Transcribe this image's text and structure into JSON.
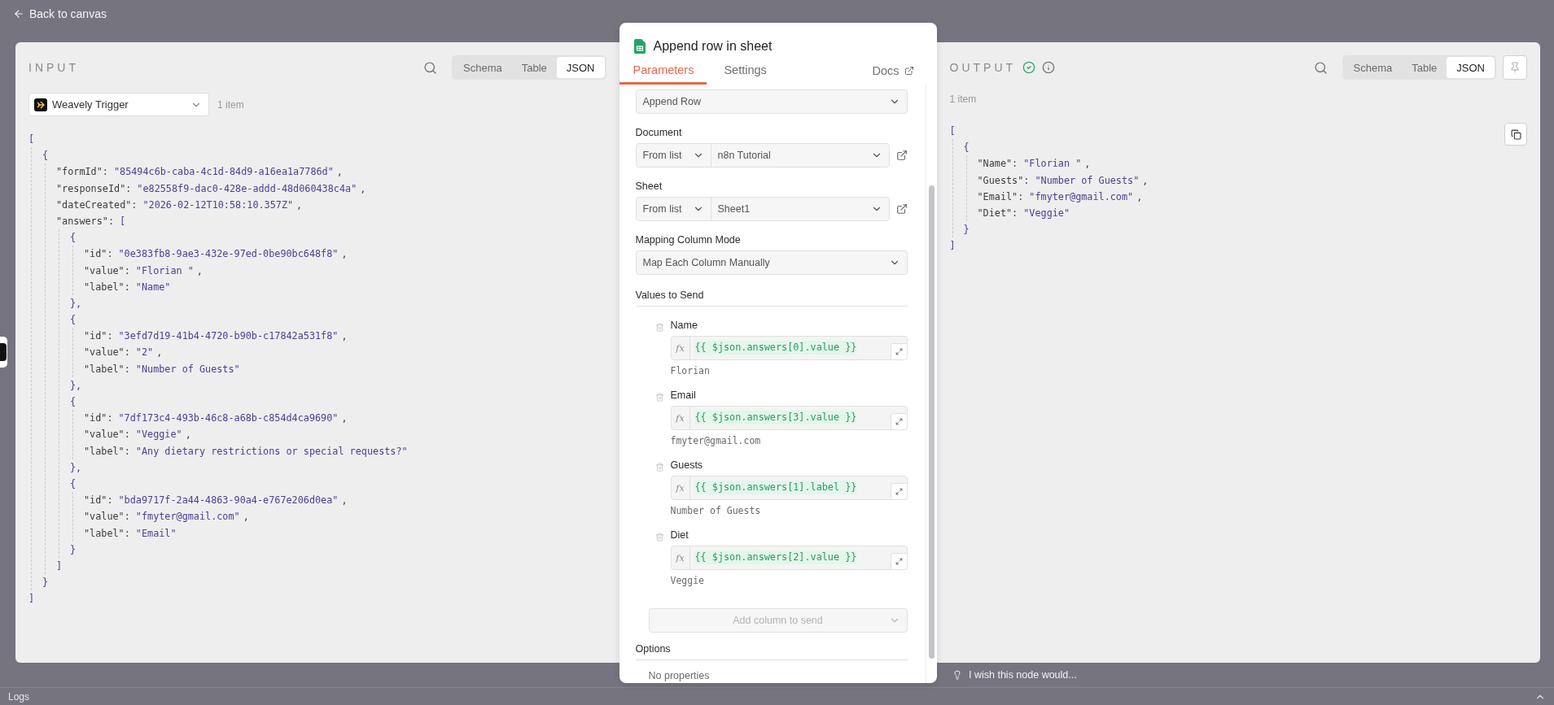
{
  "back_link": {
    "label": "Back to canvas"
  },
  "input": {
    "title": "INPUT",
    "view_tabs": [
      {
        "label": "Schema",
        "selected": false
      },
      {
        "label": "Table",
        "selected": false
      },
      {
        "label": "JSON",
        "selected": true
      }
    ],
    "node_select": {
      "value": "Weavely Trigger"
    },
    "item_count": "1 item",
    "json": {
      "open": "[",
      "close": "]",
      "children": [
        {
          "open": "{",
          "close": "}",
          "children": [
            {
              "key": "\"formId\":",
              "value": "\"85494c6b-caba-4c1d-84d9-a16ea1a7786d\"",
              "comma": ","
            },
            {
              "key": "\"responseId\":",
              "value": "\"e82558f9-dac0-428e-addd-48d060438c4a\"",
              "comma": ","
            },
            {
              "key": "\"dateCreated\":",
              "value": "\"2026-02-12T10:58:10.357Z\"",
              "comma": ","
            },
            {
              "key": "\"answers\":",
              "open": "[",
              "close": "]",
              "children": [
                {
                  "open": "{",
                  "close": "},",
                  "children": [
                    {
                      "key": "\"id\":",
                      "value": "\"0e383fb8-9ae3-432e-97ed-0be90bc648f8\"",
                      "comma": ","
                    },
                    {
                      "key": "\"value\":",
                      "value": "\"Florian \"",
                      "comma": ","
                    },
                    {
                      "key": "\"label\":",
                      "value": "\"Name\""
                    }
                  ]
                },
                {
                  "open": "{",
                  "close": "},",
                  "children": [
                    {
                      "key": "\"id\":",
                      "value": "\"3efd7d19-41b4-4720-b90b-c17842a531f8\"",
                      "comma": ","
                    },
                    {
                      "key": "\"value\":",
                      "value": "\"2\"",
                      "comma": ","
                    },
                    {
                      "key": "\"label\":",
                      "value": "\"Number of Guests\""
                    }
                  ]
                },
                {
                  "open": "{",
                  "close": "},",
                  "children": [
                    {
                      "key": "\"id\":",
                      "value": "\"7df173c4-493b-46c8-a68b-c854d4ca9690\"",
                      "comma": ","
                    },
                    {
                      "key": "\"value\":",
                      "value": "\"Veggie\"",
                      "comma": ","
                    },
                    {
                      "key": "\"label\":",
                      "value": "\"Any dietary restrictions or special requests?\""
                    }
                  ]
                },
                {
                  "open": "{",
                  "close": "}",
                  "children": [
                    {
                      "key": "\"id\":",
                      "value": "\"bda9717f-2a44-4863-90a4-e767e206d0ea\"",
                      "comma": ","
                    },
                    {
                      "key": "\"value\":",
                      "value": "\"fmyter@gmail.com\"",
                      "comma": ","
                    },
                    {
                      "key": "\"label\":",
                      "value": "\"Email\""
                    }
                  ]
                }
              ]
            }
          ]
        }
      ]
    }
  },
  "node": {
    "title": "Append row in sheet",
    "tabs": [
      {
        "label": "Parameters",
        "selected": true
      },
      {
        "label": "Settings",
        "selected": false
      }
    ],
    "docs_link": "Docs",
    "operation": {
      "value": "Append Row"
    },
    "document": {
      "label": "Document",
      "mode": "From list",
      "value": "n8n Tutorial"
    },
    "sheet": {
      "label": "Sheet",
      "mode": "From list",
      "value": "Sheet1"
    },
    "mapping_mode": {
      "label": "Mapping Column Mode",
      "value": "Map Each Column Manually"
    },
    "values_title": "Values to Send",
    "values": [
      {
        "name": "Name",
        "fx": "fx",
        "expression": "{{ $json.answers[0].value }}",
        "result": "Florian"
      },
      {
        "name": "Email",
        "fx": "fx",
        "expression": "{{ $json.answers[3].value }}",
        "result": "fmyter@gmail.com"
      },
      {
        "name": "Guests",
        "fx": "fx",
        "expression": "{{ $json.answers[1].label }}",
        "result": "Number of Guests"
      },
      {
        "name": "Diet",
        "fx": "fx",
        "expression": "{{ $json.answers[2].value }}",
        "result": "Veggie"
      }
    ],
    "add_column": {
      "placeholder": "Add column to send",
      "disabled": true
    },
    "options": {
      "title": "Options",
      "empty_text": "No properties"
    }
  },
  "output": {
    "title": "OUTPUT",
    "success": true,
    "view_tabs": [
      {
        "label": "Schema",
        "selected": false
      },
      {
        "label": "Table",
        "selected": false
      },
      {
        "label": "JSON",
        "selected": true
      }
    ],
    "item_count": "1 item",
    "json": {
      "open": "[",
      "close": "]",
      "children": [
        {
          "open": "{",
          "close": "}",
          "children": [
            {
              "key": "\"Name\":",
              "value": "\"Florian \"",
              "comma": ","
            },
            {
              "key": "\"Guests\":",
              "value": "\"Number of Guests\"",
              "comma": ","
            },
            {
              "key": "\"Email\":",
              "value": "\"fmyter@gmail.com\"",
              "comma": ","
            },
            {
              "key": "\"Diet\":",
              "value": "\"Veggie\""
            }
          ]
        }
      ]
    }
  },
  "feedback": {
    "text": "I wish this node would..."
  },
  "logs": {
    "label": "Logs",
    "expanded": false
  }
}
